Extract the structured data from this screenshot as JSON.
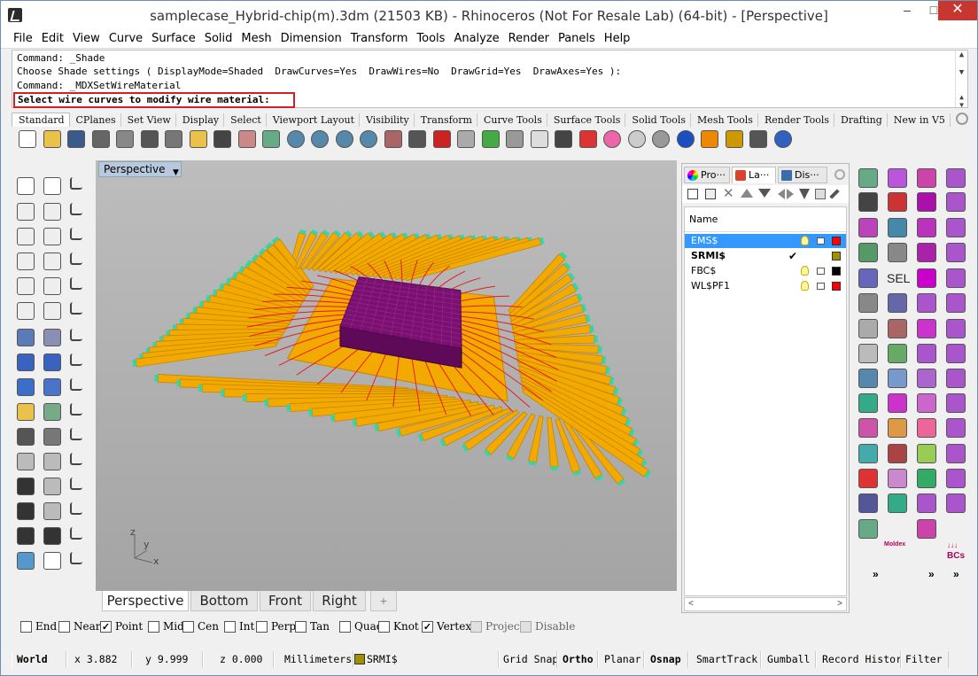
{
  "window": {
    "title": "samplecase_Hybrid-chip(m).3dm (21503 KB) - Rhinoceros (Not For Resale Lab) (64-bit) - [Perspective]",
    "minimize": "–",
    "maximize": "□",
    "close": "✕"
  },
  "menu": [
    "File",
    "Edit",
    "View",
    "Curve",
    "Surface",
    "Solid",
    "Mesh",
    "Dimension",
    "Transform",
    "Tools",
    "Analyze",
    "Render",
    "Panels",
    "Help"
  ],
  "command": {
    "history": [
      "Command: _Shade",
      "Choose Shade settings ( DisplayMode=Shaded  DrawCurves=Yes  DrawWires=No  DrawGrid=Yes  DrawAxes=Yes ):",
      "Command: _MDXSetWireMaterial"
    ],
    "prompt": "Select wire curves to modify wire material:",
    "prompt_border_color": "#d62020"
  },
  "toolbar_tabs": [
    "Standard",
    "CPlanes",
    "Set View",
    "Display",
    "Select",
    "Viewport Layout",
    "Visibility",
    "Transform",
    "Curve Tools",
    "Surface Tools",
    "Solid Tools",
    "Mesh Tools",
    "Render Tools",
    "Drafting",
    "New in V5"
  ],
  "toolbar_icons": [
    "new-icon",
    "open-icon",
    "save-icon",
    "print-icon",
    "import-icon",
    "cut-icon",
    "copy-icon",
    "paste-icon",
    "undo-icon",
    "pan-icon",
    "rotate-view-icon",
    "zoom-icon",
    "zoom-window-icon",
    "zoom-extents-icon",
    "zoom-selected-icon",
    "rotate-3d-icon",
    "four-views-icon",
    "car-icon",
    "cplane-icon",
    "object-snap-icon",
    "select-icon",
    "light-icon",
    "lock-icon",
    "layer-color-icon",
    "color-wheel-icon",
    "shade-sphere-icon",
    "render-sphere-icon",
    "blue-sphere-icon",
    "brush-icon",
    "gear-icon",
    "grid-icon",
    "help-icon"
  ],
  "viewport": {
    "title": "Perspective",
    "tabs": [
      "Perspective",
      "Bottom",
      "Front",
      "Right"
    ],
    "active_tab": "Perspective",
    "add_tab": "+",
    "axis_labels": {
      "z": "z",
      "y": "y",
      "x": "x"
    }
  },
  "panel": {
    "tabs": [
      "Pro···",
      "La···",
      "Dis···"
    ],
    "header_name": "Name",
    "layers": [
      {
        "name": "EMS$",
        "selected": true,
        "current": false,
        "color": "#ff0000",
        "bold": false
      },
      {
        "name": "SRMI$",
        "selected": false,
        "current": true,
        "color": "#a09000",
        "bold": true
      },
      {
        "name": "FBC$",
        "selected": false,
        "current": false,
        "color": "#000000",
        "bold": false
      },
      {
        "name": "WL$PF1",
        "selected": false,
        "current": false,
        "color": "#ff0000",
        "bold": false
      }
    ],
    "scroll_left": "<",
    "scroll_right": ">"
  },
  "right_tools": {
    "labels": [
      "SEL",
      "Moldex",
      "↓↓↓",
      "BCs"
    ],
    "more": "»"
  },
  "osnap": [
    {
      "label": "End",
      "checked": false,
      "enabled": true
    },
    {
      "label": "Near",
      "checked": false,
      "enabled": true
    },
    {
      "label": "Point",
      "checked": true,
      "enabled": true
    },
    {
      "label": "Mid",
      "checked": false,
      "enabled": true
    },
    {
      "label": "Cen",
      "checked": false,
      "enabled": true
    },
    {
      "label": "Int",
      "checked": false,
      "enabled": true
    },
    {
      "label": "Perp",
      "checked": false,
      "enabled": true
    },
    {
      "label": "Tan",
      "checked": false,
      "enabled": true
    },
    {
      "label": "Quad",
      "checked": false,
      "enabled": true
    },
    {
      "label": "Knot",
      "checked": false,
      "enabled": true
    },
    {
      "label": "Vertex",
      "checked": true,
      "enabled": true
    },
    {
      "label": "Project",
      "checked": false,
      "enabled": false
    },
    {
      "label": "Disable",
      "checked": false,
      "enabled": false
    }
  ],
  "status": {
    "cplane": "World",
    "x": "x 3.882",
    "y": "y 9.999",
    "z": "z 0.000",
    "units": "Millimeters",
    "layer": "SRMI$",
    "layer_color": "#a09000",
    "grid_snap": "Grid Snap",
    "ortho": "Ortho",
    "planar": "Planar",
    "osnap": "Osnap",
    "smarttrack": "SmartTrack",
    "gumball": "Gumball",
    "record_history": "Record History",
    "filter": "Filter"
  },
  "colors": {
    "lead": "#f2a900",
    "lead_edge": "#c98400",
    "die": "#7a1070",
    "wire": "#e51c1c",
    "pad": "#37d4a8",
    "selected_row": "#3399ff"
  }
}
